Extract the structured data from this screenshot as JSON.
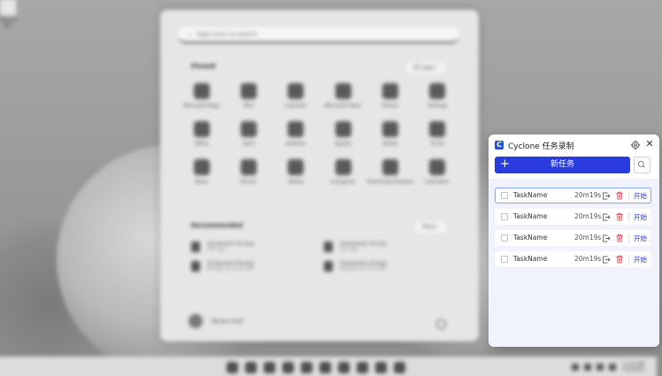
{
  "desktop": {
    "icon_label": "Recycle Bin",
    "start_menu": {
      "search_placeholder": "Type here to search",
      "pinned_heading": "Pinned",
      "all_apps_label": "All apps  ›",
      "apps": [
        "Microsoft Edge",
        "Mail",
        "Calendar",
        "Microsoft Store",
        "Photos",
        "Settings",
        "Office",
        "Xbox",
        "Solitaire",
        "Spotify",
        "Netflix",
        "To Do",
        "News",
        "PicsArt",
        "Twitter",
        "Instagram",
        "Photoshop Express",
        "Calculator"
      ],
      "recommended_heading": "Recommended",
      "more_label": "More  ›",
      "recommended": [
        {
          "title": "Screenshot (5).png",
          "sub": "14h ago"
        },
        {
          "title": "Screenshot (3).png",
          "sub": "12h ago"
        },
        {
          "title": "Screenshot (6).png",
          "sub": "Monday at 11:32 AM"
        },
        {
          "title": "Screenshot (4).png",
          "sub": "Monday at 11:31 AM"
        }
      ],
      "user_name": "Miriam Graf"
    },
    "clock": {
      "time": "11:32 AM",
      "date": "7/10/2023"
    }
  },
  "panel": {
    "title": "Cyclone 任务录制",
    "logo_letter": "C",
    "new_task_label": "新任务",
    "accent": "#2a3ce0",
    "tasks": [
      {
        "name": "TaskName",
        "time": "20m19s",
        "action": "开始",
        "selected": true
      },
      {
        "name": "TaskName",
        "time": "20m19s",
        "action": "开始",
        "selected": false
      },
      {
        "name": "TaskName",
        "time": "20m19s",
        "action": "开始",
        "selected": false
      },
      {
        "name": "TaskName",
        "time": "20m19s",
        "action": "开始",
        "selected": false
      }
    ]
  }
}
